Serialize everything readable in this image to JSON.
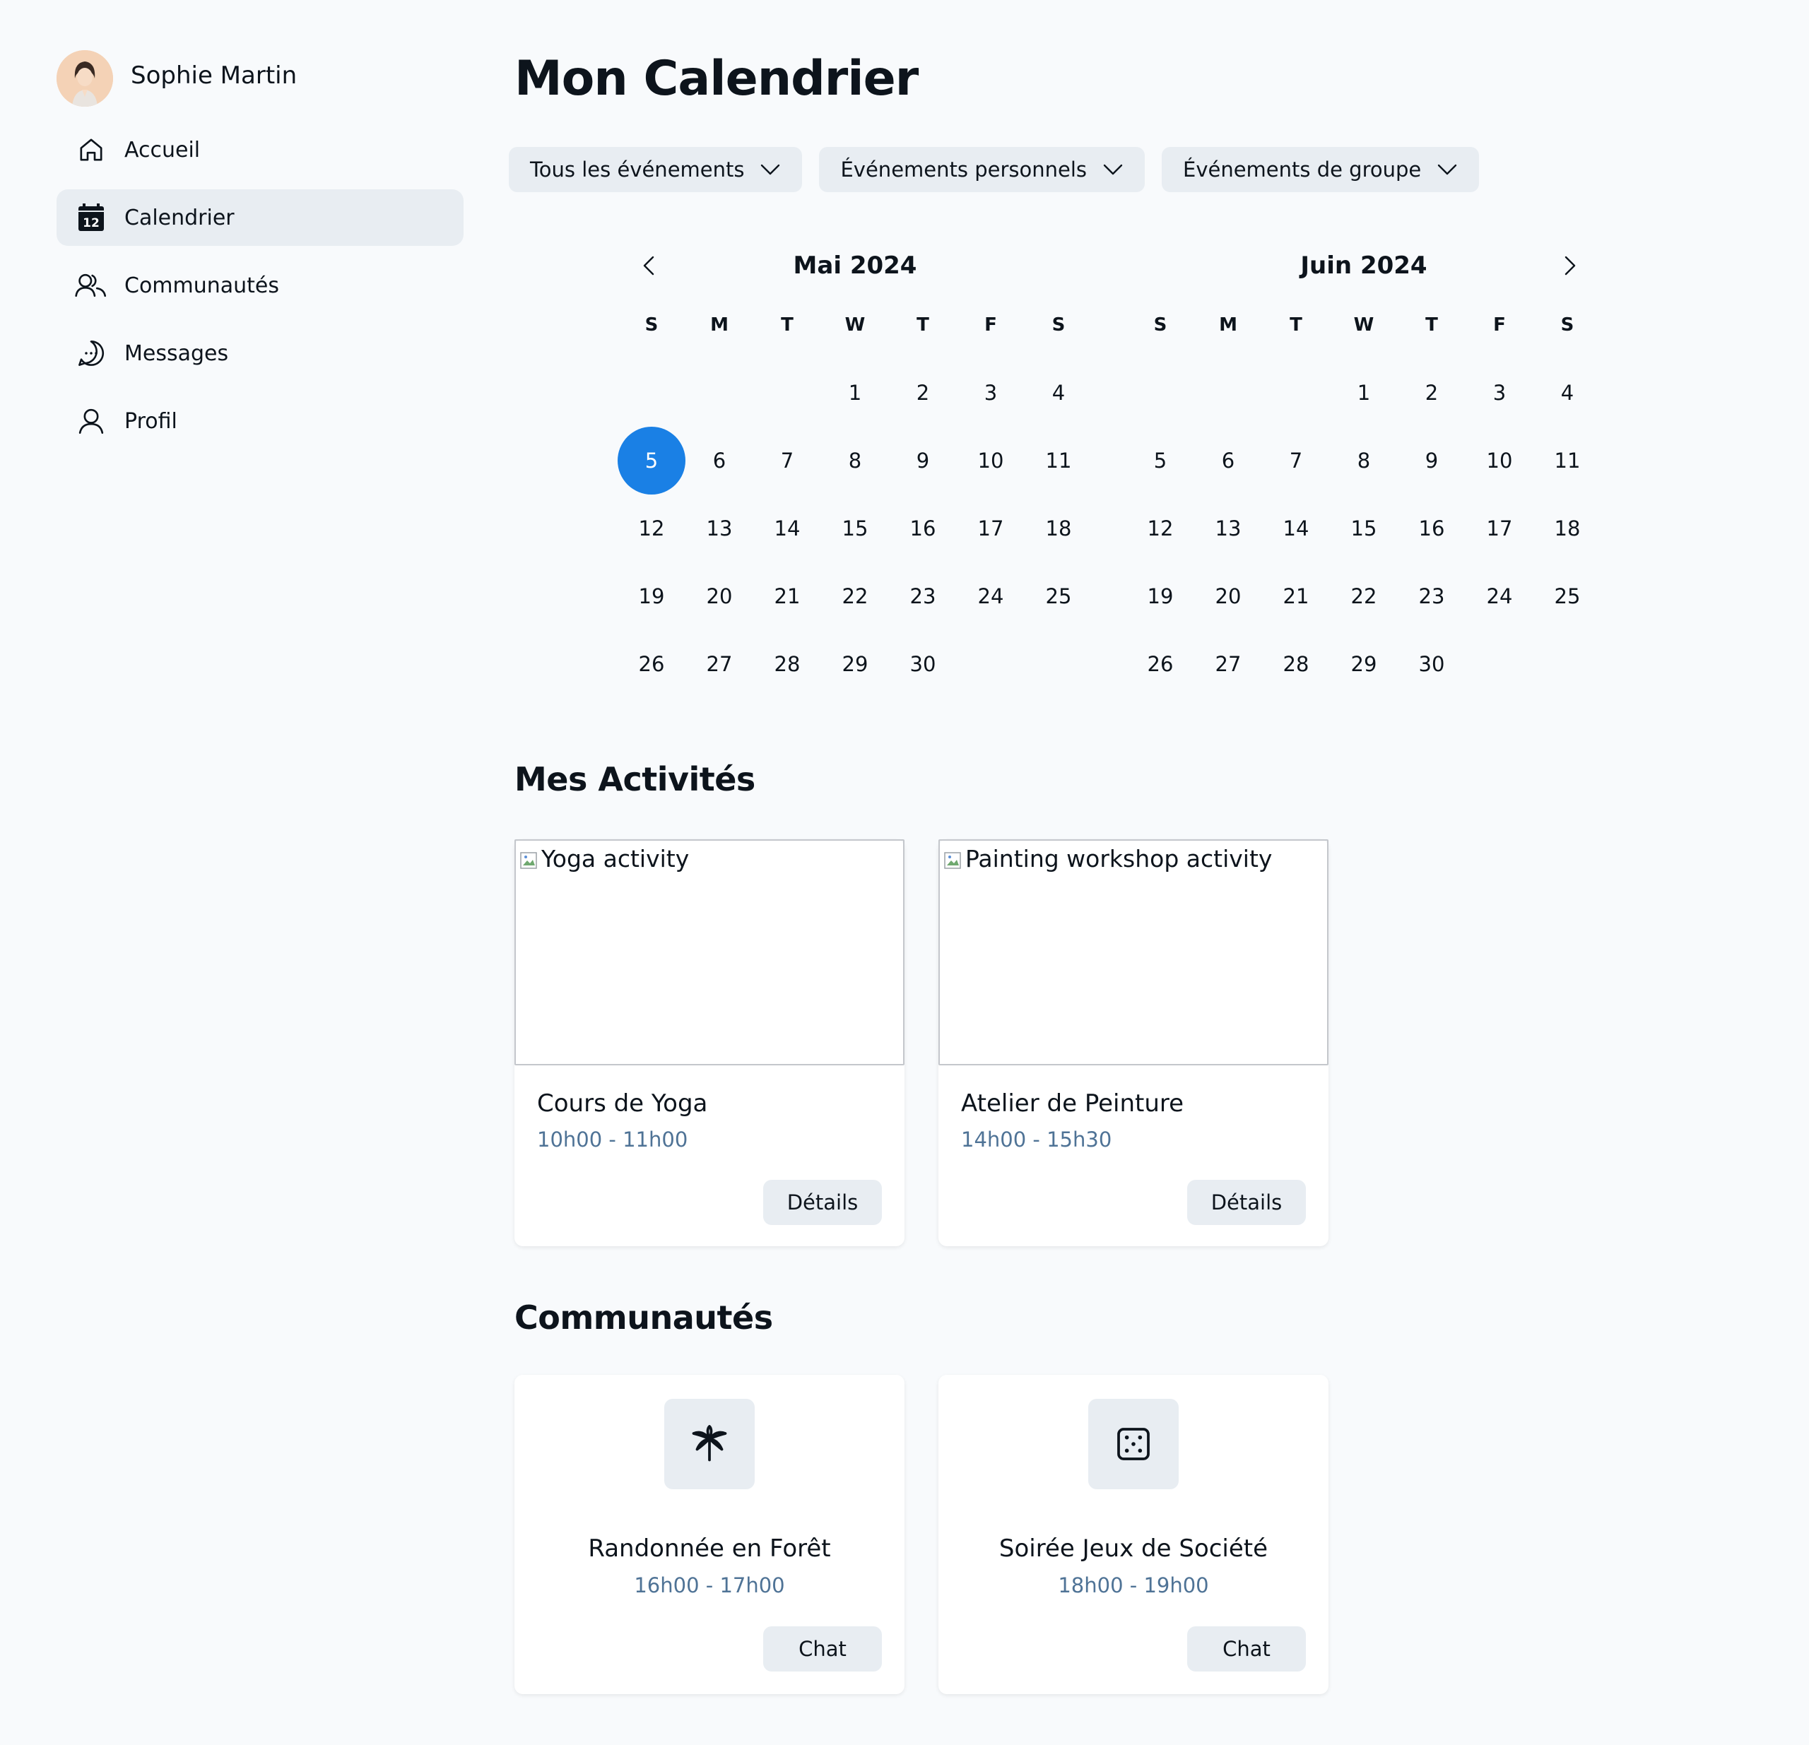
{
  "user": {
    "name": "Sophie Martin"
  },
  "sidebar": {
    "items": [
      {
        "label": "Accueil",
        "icon": "house-icon"
      },
      {
        "label": "Calendrier",
        "icon": "calendar-icon",
        "badge": "12",
        "active": true
      },
      {
        "label": "Communautés",
        "icon": "users-icon"
      },
      {
        "label": "Messages",
        "icon": "chat-bubble-icon"
      },
      {
        "label": "Profil",
        "icon": "user-icon"
      }
    ]
  },
  "page": {
    "title": "Mon Calendrier"
  },
  "filters": [
    {
      "label": "Tous les événements"
    },
    {
      "label": "Événements personnels"
    },
    {
      "label": "Événements de groupe"
    }
  ],
  "calendar": {
    "weekdays": [
      "S",
      "M",
      "T",
      "W",
      "T",
      "F",
      "S"
    ],
    "selected_day": 5,
    "months": [
      {
        "title": "Mai 2024",
        "weeks": [
          [
            "",
            "",
            "",
            "1",
            "2",
            "3",
            "4"
          ],
          [
            "5",
            "6",
            "7",
            "8",
            "9",
            "10",
            "11"
          ],
          [
            "12",
            "13",
            "14",
            "15",
            "16",
            "17",
            "18"
          ],
          [
            "19",
            "20",
            "21",
            "22",
            "23",
            "24",
            "25"
          ],
          [
            "26",
            "27",
            "28",
            "29",
            "30",
            "",
            ""
          ]
        ]
      },
      {
        "title": "Juin 2024",
        "weeks": [
          [
            "",
            "",
            "",
            "1",
            "2",
            "3",
            "4"
          ],
          [
            "5",
            "6",
            "7",
            "8",
            "9",
            "10",
            "11"
          ],
          [
            "12",
            "13",
            "14",
            "15",
            "16",
            "17",
            "18"
          ],
          [
            "19",
            "20",
            "21",
            "22",
            "23",
            "24",
            "25"
          ],
          [
            "26",
            "27",
            "28",
            "29",
            "30",
            "",
            ""
          ]
        ]
      }
    ]
  },
  "activities": {
    "title": "Mes Activités",
    "items": [
      {
        "image_alt": "Yoga activity",
        "title": "Cours de Yoga",
        "time": "10h00 - 11h00",
        "button": "Détails"
      },
      {
        "image_alt": "Painting workshop activity",
        "title": "Atelier de Peinture",
        "time": "14h00 - 15h30",
        "button": "Détails"
      }
    ]
  },
  "communities": {
    "title": "Communautés",
    "items": [
      {
        "icon": "palm-tree-icon",
        "title": "Randonnée en Forêt",
        "time": "16h00 - 17h00",
        "button": "Chat"
      },
      {
        "icon": "dice-icon",
        "title": "Soirée Jeux de Société",
        "time": "18h00 - 19h00",
        "button": "Chat"
      }
    ]
  },
  "colors": {
    "accent": "#1a80e5",
    "muted_text": "#4f7396",
    "chip_bg": "#e8edf2",
    "background": "#f8fafc"
  }
}
